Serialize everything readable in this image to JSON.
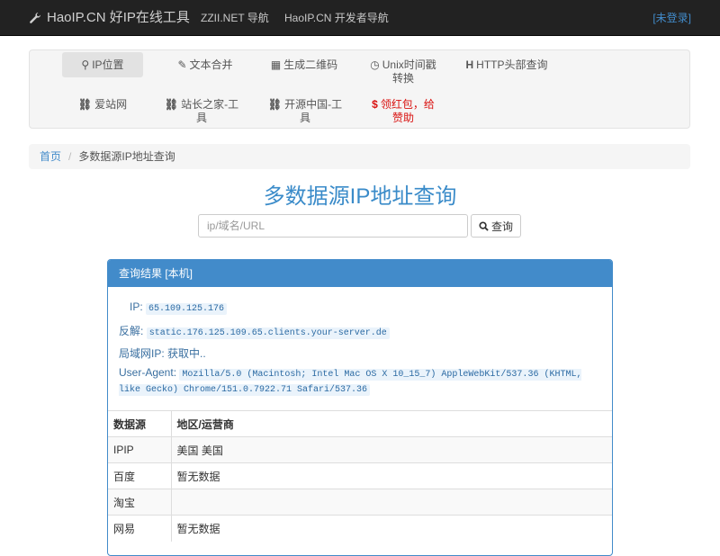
{
  "navbar": {
    "brand": "HaoIP.CN 好IP在线工具",
    "links": [
      "ZZII.NET 导航",
      "HaoIP.CN 开发者导航"
    ],
    "login": "[未登录]"
  },
  "tools": [
    {
      "icon": "map-marker-icon",
      "glyph": "⚲",
      "label": "IP位置",
      "active": true
    },
    {
      "icon": "pencil-icon",
      "glyph": "✎",
      "label": "文本合并"
    },
    {
      "icon": "qrcode-icon",
      "glyph": "▦",
      "label": "生成二维码"
    },
    {
      "icon": "clock-icon",
      "glyph": "◷",
      "label": "Unix时间戳转换"
    },
    {
      "icon": "header-icon",
      "glyph": "H",
      "label": "HTTP头部查询"
    },
    {
      "icon": "link-icon",
      "glyph": "⛓",
      "label": "爱站网"
    },
    {
      "icon": "link-icon",
      "glyph": "⛓",
      "label": "站长之家-工具"
    },
    {
      "icon": "link-icon",
      "glyph": "⛓",
      "label": "开源中国-工具"
    },
    {
      "icon": "dollar-icon",
      "glyph": "$",
      "label": "领红包，给赞助"
    }
  ],
  "breadcrumb": {
    "home": "首页",
    "separator": "/",
    "current": "多数据源IP地址查询"
  },
  "page_title": "多数据源IP地址查询",
  "search": {
    "placeholder": "ip/域名/URL",
    "value": "",
    "button_label": "查询"
  },
  "panel": {
    "title": "查询结果 [本机]",
    "ip_label": "IP:",
    "ip_value": "65.109.125.176",
    "reverse_label": "反解:",
    "reverse_value": "static.176.125.109.65.clients.your-server.de",
    "lan_label": "局域网IP:",
    "lan_value": "获取中..",
    "ua_label": "User-Agent:",
    "ua_value": "Mozilla/5.0 (Macintosh; Intel Mac OS X 10_15_7) AppleWebKit/537.36 (KHTML, like Gecko) Chrome/151.0.7922.71 Safari/537.36"
  },
  "table": {
    "headers": [
      "数据源",
      "地区/运营商"
    ],
    "rows": [
      [
        "IPIP",
        "美国 美国"
      ],
      [
        "百度",
        "暂无数据"
      ],
      [
        "淘宝",
        ""
      ],
      [
        "网易",
        "暂无数据"
      ]
    ]
  },
  "colors": {
    "navbar": "#222222",
    "accent": "#428bca",
    "sponsor": "#d9110f"
  }
}
